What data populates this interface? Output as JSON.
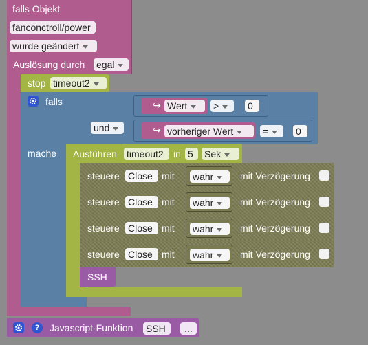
{
  "trigger": {
    "label": "falls Objekt",
    "object_id": "fanconctroll/power",
    "event": "wurde geändert",
    "trigger_label": "Auslösung durch",
    "trigger_value": "egal"
  },
  "stop_block": {
    "label": "stop",
    "timer": "timeout2"
  },
  "if_block": {
    "falls": "falls",
    "mache": "mache",
    "cond1": {
      "var": "Wert",
      "op": ">",
      "value": "0"
    },
    "logic": "und",
    "cond2": {
      "var": "vorheriger Wert",
      "op": "=",
      "value": "0"
    }
  },
  "timeout_block": {
    "label": "Ausführen",
    "name": "timeout2",
    "in": "in",
    "delay": "5",
    "unit": "Sek"
  },
  "control_rows": [
    {
      "steuere": "steuere",
      "target": "Close",
      "mit": "mit",
      "value": "wahr",
      "delay_label": "mit Verzögerung"
    },
    {
      "steuere": "steuere",
      "target": "Close",
      "mit": "mit",
      "value": "wahr",
      "delay_label": "mit Verzögerung"
    },
    {
      "steuere": "steuere",
      "target": "Close",
      "mit": "mit",
      "value": "wahr",
      "delay_label": "mit Verzögerung"
    },
    {
      "steuere": "steuere",
      "target": "Close",
      "mit": "mit",
      "value": "wahr",
      "delay_label": "mit Verzögerung"
    }
  ],
  "ssh_call": "SSH",
  "js_function": {
    "label": "Javascript-Funktion",
    "name": "SSH",
    "more": "..."
  },
  "colors": {
    "trigger": "#b05c8e",
    "logic": "#5b80a5",
    "timer": "#a3b545",
    "control": "#7b7b52",
    "function": "#9a5ba5",
    "background": "#8c8c8c"
  }
}
